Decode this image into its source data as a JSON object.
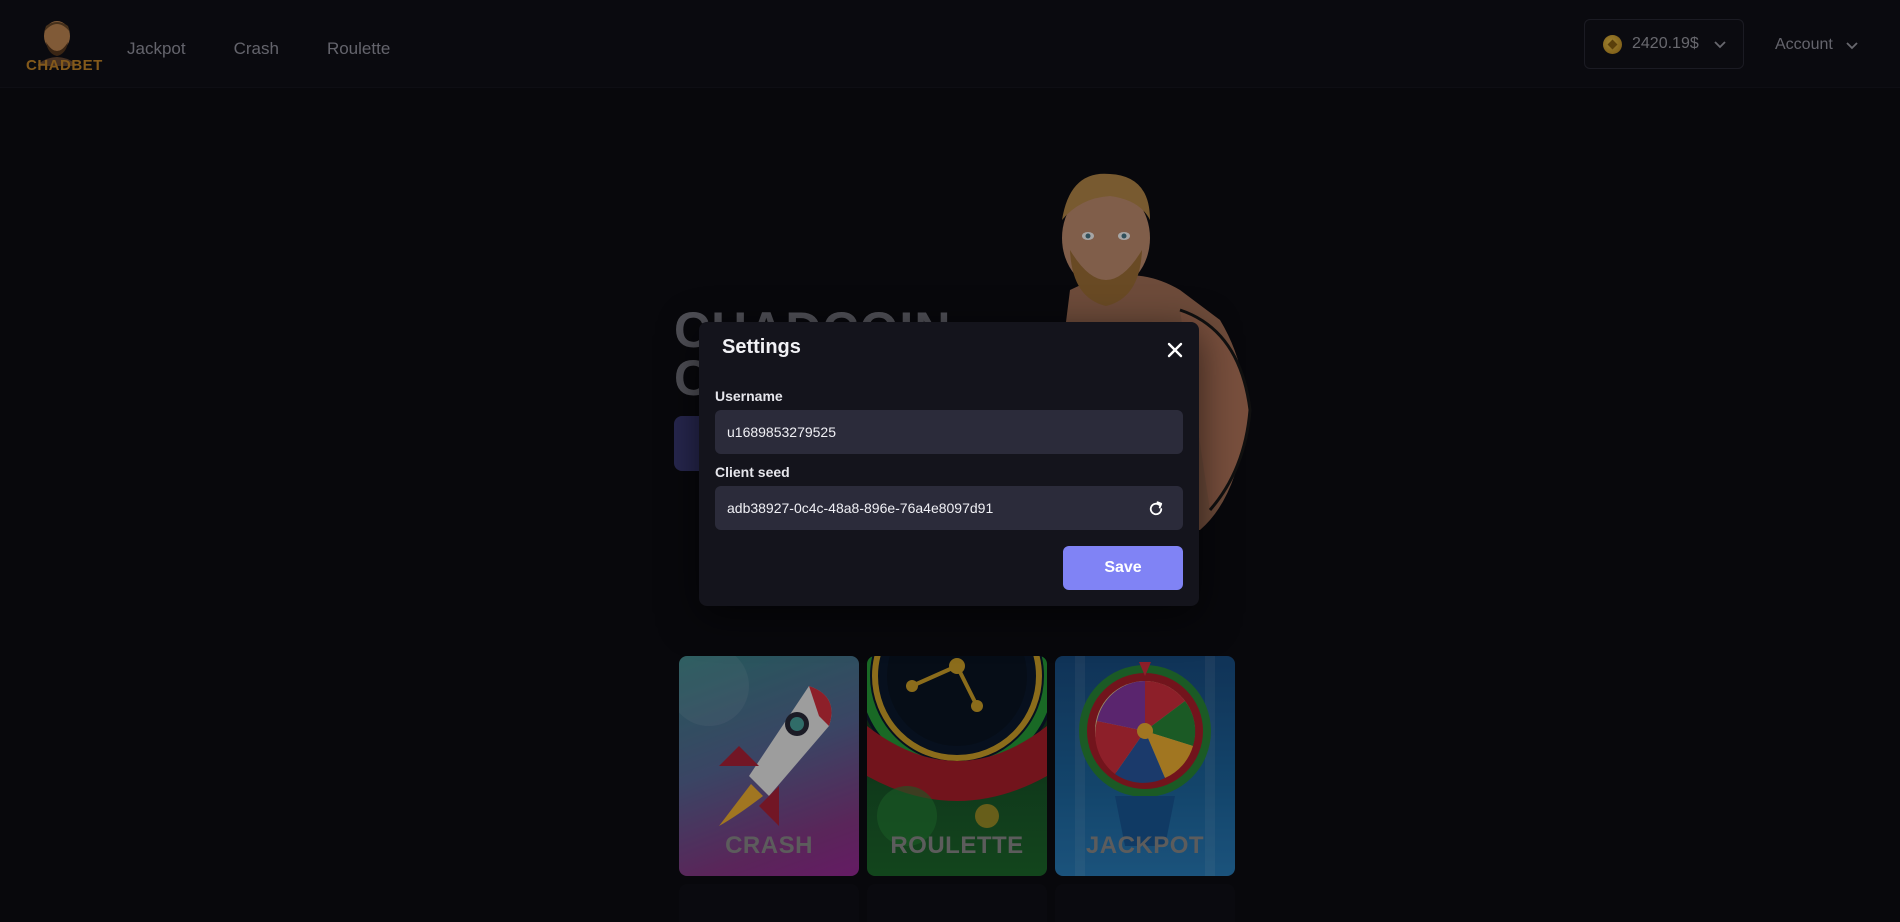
{
  "header": {
    "logo_text": "CHADBET",
    "nav": [
      "Jackpot",
      "Crash",
      "Roulette"
    ],
    "balance": "2420.19$",
    "account_label": "Account"
  },
  "hero": {
    "title_line1": "CHADCOIN",
    "title_line2": "C"
  },
  "games": [
    {
      "label": "CRASH"
    },
    {
      "label": "ROULETTE"
    },
    {
      "label": "JACKPOT"
    }
  ],
  "modal": {
    "title": "Settings",
    "username_label": "Username",
    "username_value": "u1689853279525",
    "client_seed_label": "Client seed",
    "client_seed_value": "adb38927-0c4c-48a8-896e-76a4e8097d91",
    "save_label": "Save"
  },
  "colors": {
    "accent": "#8083f5",
    "background": "#0d0d13",
    "coin": "#d4a02a"
  }
}
